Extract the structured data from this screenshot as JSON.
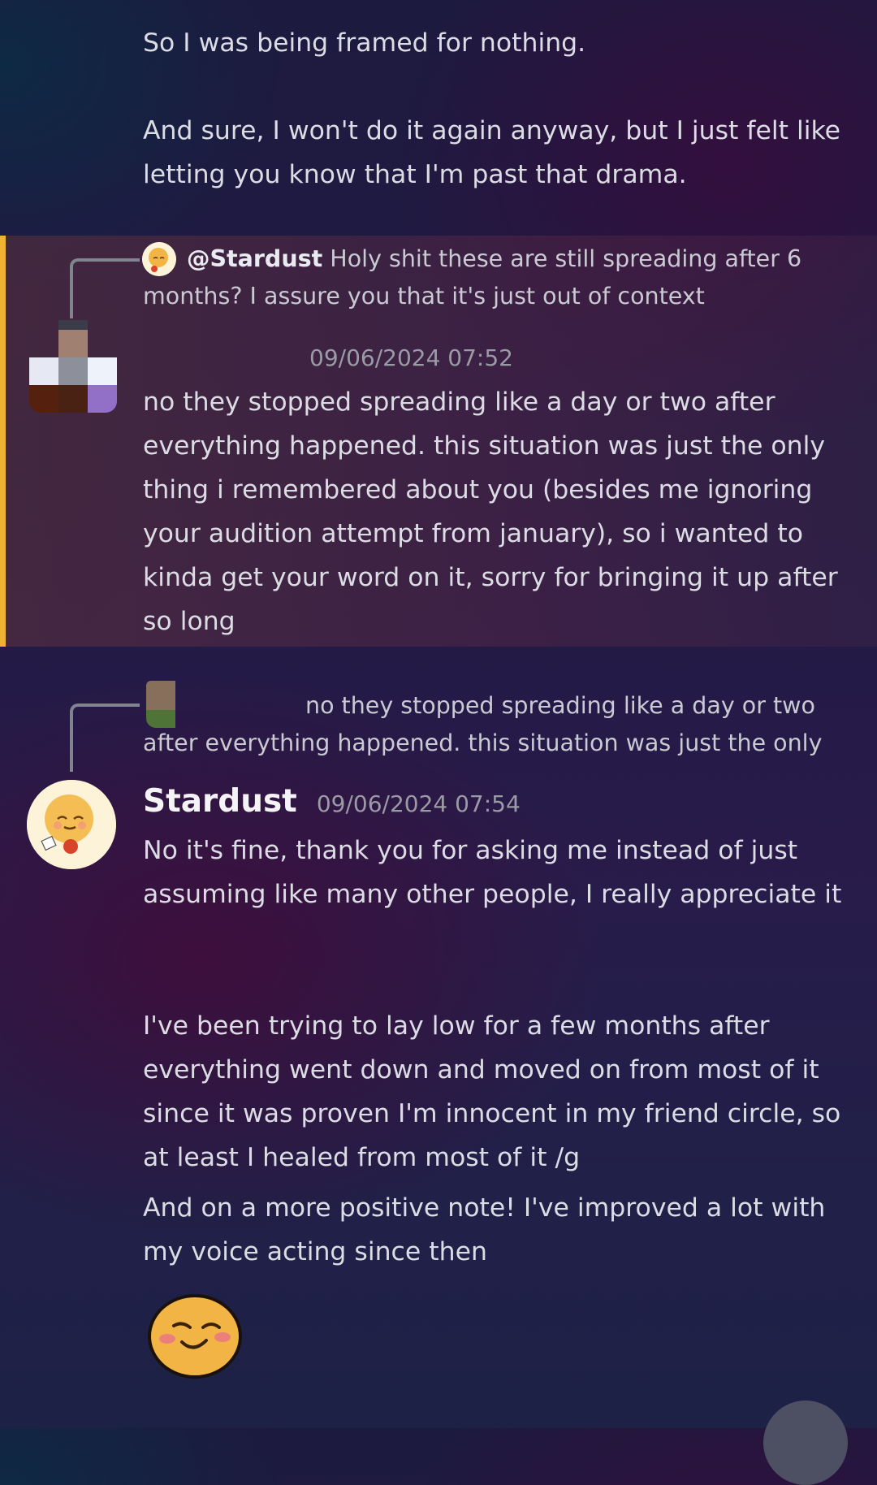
{
  "messages": {
    "top": {
      "line1": "So I was being framed for nothing.",
      "para2": "And sure, I won't do it again anyway, but I just felt like letting you know that I'm past that drama."
    },
    "highlighted": {
      "reply_mention": "@Stardust",
      "reply_text": "Holy shit these are still spreading after 6 months? I assure you that it's just out of context",
      "timestamp": "09/06/2024 07:52",
      "body": "no they stopped spreading like a day or two after everything happened. this situation was just the only thing i remembered about you (besides me ignoring your audition attempt from january), so i wanted to kinda get your word on it, sorry for bringing it up after so long"
    },
    "stardust": {
      "reply_text": "no they stopped spreading like a day or two after everything happened. this situation was just the only",
      "author": "Stardust",
      "timestamp": "09/06/2024 07:54",
      "body1": "No it's fine, thank you for asking me instead of just assuming like many other people, I really appreciate it",
      "body2": "I've been trying to lay low for a few months after everything went down and moved on from most of it since it was proven I'm innocent in my friend circle, so at least I healed from most of it /g",
      "body3": "And on a more positive note! I've improved a lot with my voice acting since then"
    }
  },
  "colors": {
    "highlight_bar": "#f0b232",
    "emoji_fill": "#f2b444",
    "avatar_bg": "#fdf3d8"
  },
  "icons": {
    "emoji": "blushing-smile-emoji",
    "fab": "scroll-button"
  }
}
